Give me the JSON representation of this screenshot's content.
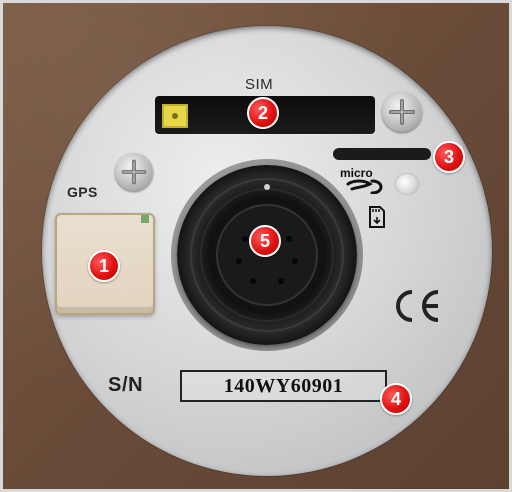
{
  "labels": {
    "sim": "SIM",
    "gps": "GPS",
    "sn": "S/N",
    "serial_number": "140WY60901"
  },
  "marks": {
    "micro_sd_logo_text": "micro SD",
    "ce_mark_text": "CE"
  },
  "callouts": [
    {
      "num": "1"
    },
    {
      "num": "2"
    },
    {
      "num": "3"
    },
    {
      "num": "4"
    },
    {
      "num": "5"
    }
  ],
  "colors": {
    "callout_red": "#e01212",
    "disc_silver": "#d7d8da",
    "background_brown": "#6a4c39"
  }
}
